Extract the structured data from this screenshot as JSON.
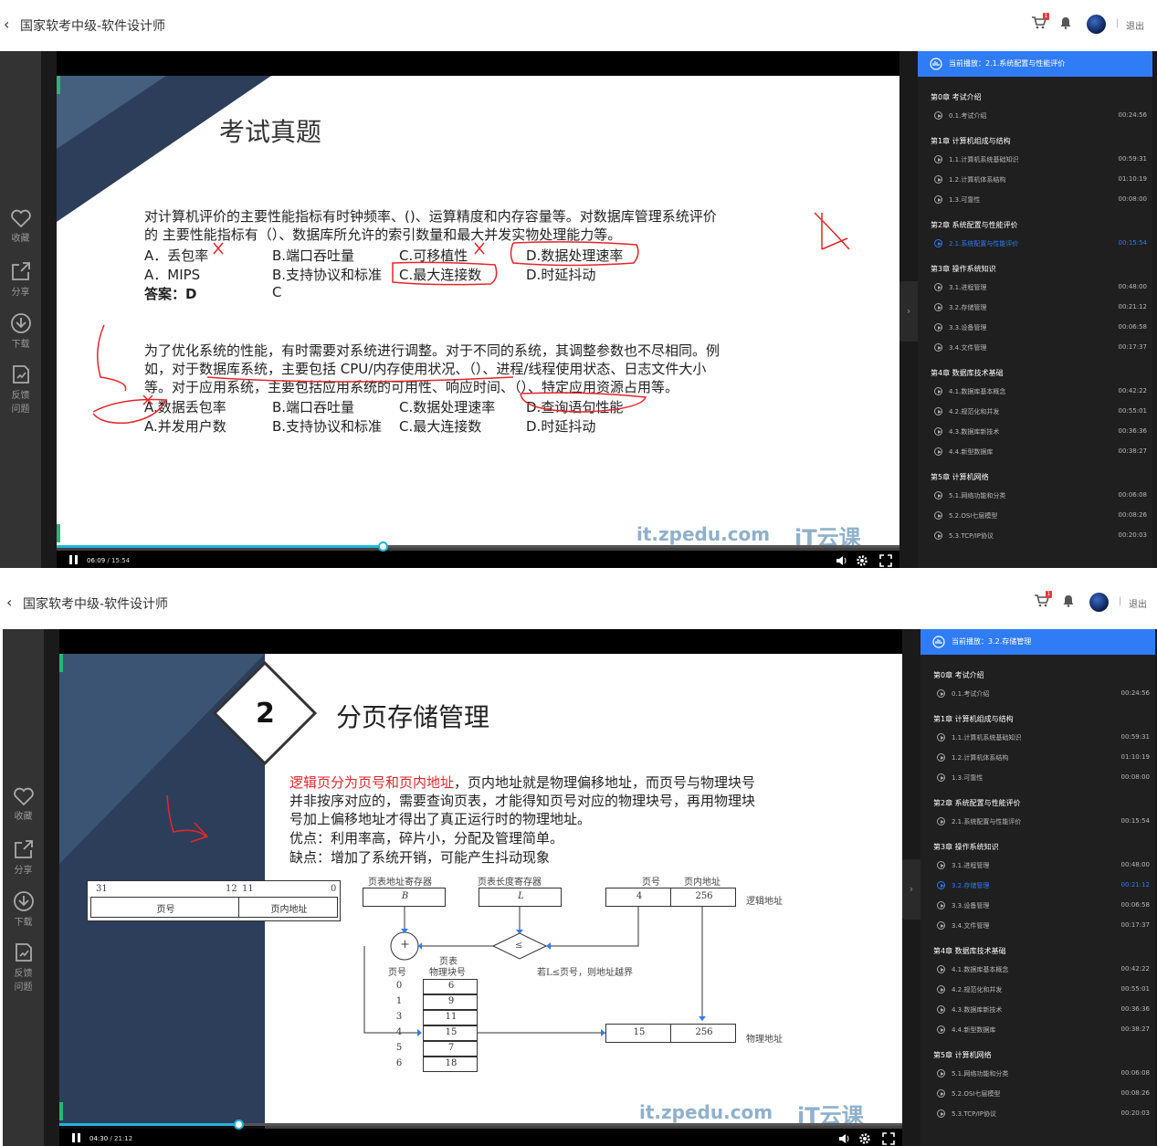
{
  "header": {
    "back_icon": "chevron-left-icon",
    "course_title": "国家软考中级-软件设计师",
    "cart_badge": "1",
    "separator": "|",
    "logout": "退出"
  },
  "leftbar": {
    "favorite": "收藏",
    "share": "分享",
    "download": "下载",
    "feedback_1": "反馈",
    "feedback_2": "问题"
  },
  "colors": {
    "accent": "#2f7cf6",
    "progress": "#27b3d9",
    "annotation": "#e3262b"
  },
  "player1": {
    "current_time": "06:09",
    "total_time": "15:54",
    "progress": 0.387,
    "now_playing": "当前播放：2.1.系统配置与性能评价"
  },
  "player2": {
    "current_time": "04:30",
    "total_time": "21:12",
    "progress": 0.212,
    "now_playing": "当前播放：3.2.存储管理"
  },
  "playlist": [
    {
      "chapter": "第0章 考试介绍",
      "lessons": [
        {
          "name": "0.1.考试介绍",
          "duration": "00:24:56"
        }
      ]
    },
    {
      "chapter": "第1章 计算机组成与结构",
      "lessons": [
        {
          "name": "1.1.计算机系统基础知识",
          "duration": "00:59:31"
        },
        {
          "name": "1.2.计算机体系结构",
          "duration": "01:10:19"
        },
        {
          "name": "1.3.可靠性",
          "duration": "00:08:00"
        }
      ]
    },
    {
      "chapter": "第2章 系统配置与性能评价",
      "lessons": [
        {
          "name": "2.1.系统配置与性能评价",
          "duration": "00:15:54"
        }
      ]
    },
    {
      "chapter": "第3章 操作系统知识",
      "lessons": [
        {
          "name": "3.1.进程管理",
          "duration": "00:48:00"
        },
        {
          "name": "3.2.存储管理",
          "duration": "00:21:12"
        },
        {
          "name": "3.3.设备管理",
          "duration": "00:06:58"
        },
        {
          "name": "3.4.文件管理",
          "duration": "00:17:37"
        }
      ]
    },
    {
      "chapter": "第4章 数据库技术基础",
      "lessons": [
        {
          "name": "4.1.数据库基本概念",
          "duration": "00:42:22"
        },
        {
          "name": "4.2.规范化和并发",
          "duration": "00:55:01"
        },
        {
          "name": "4.3.数据库新技术",
          "duration": "00:36:36"
        },
        {
          "name": "4.4.新型数据库",
          "duration": "00:38:27"
        }
      ]
    },
    {
      "chapter": "第5章 计算机网络",
      "lessons": [
        {
          "name": "5.1.网络功能和分类",
          "duration": "00:06:08"
        },
        {
          "name": "5.2.OSI七层模型",
          "duration": "00:08:26"
        },
        {
          "name": "5.3.TCP/IP协议",
          "duration": "00:20:03"
        }
      ]
    }
  ],
  "slide1": {
    "title": "考试真题",
    "q1_line1": "对计算机评价的主要性能指标有时钟频率、()、运算精度和内存容量等。对数据库管理系统评价",
    "q1_line2": "的 主要性能指标有（）、数据库所允许的索引数量和最大并发实物处理能力等。",
    "q1_opts_row1": [
      "A．丢包率",
      "B.端口吞吐量",
      "C.可移植性",
      "D.数据处理速率"
    ],
    "q1_opts_row2": [
      "A．MIPS",
      "B.支持协议和标准",
      "C.最大连接数",
      "D.时延抖动"
    ],
    "answer": "答案：D",
    "answer2": "C",
    "q2_line1": "为了优化系统的性能，有时需要对系统进行调整。对于不同的系统，其调整参数也不尽相同。例",
    "q2_line2": "如，对于数据库系统，主要包括 CPU/内存使用状况、（）、进程/线程使用状态、日志文件大小",
    "q2_line3": "等。对于应用系统，主要包括应用系统的可用性、响应时间、（）、特定应用资源占用等。",
    "q2_opts_row1": [
      "A.数据丢包率",
      "B.端口吞吐量",
      "C.数据处理速率",
      "D.查询语句性能"
    ],
    "q2_opts_row2": [
      "A.并发用户数",
      "B.支持协议和标准",
      "C.最大连接数",
      "D.时延抖动"
    ],
    "watermark_url": "it.zpedu.com",
    "watermark_brand": "iT云课"
  },
  "slide2": {
    "number": "2",
    "title": "分页存储管理",
    "line1_red": "逻辑页分为页号和页内地址",
    "line1_rest": "，页内地址就是物理偏移地址，而页号与物理块号",
    "line2": "并非按序对应的，需要查询页表，才能得知页号对应的物理块号，再用物理块",
    "line3": "号加上偏移地址才得出了真正运行时的物理地址。",
    "line4": "优点：利用率高，碎片小，分配及管理简单。",
    "line5": "缺点：增加了系统开销，可能产生抖动现象",
    "diagram": {
      "addr_bits": [
        "31",
        "12",
        "11",
        "0"
      ],
      "addr_fields": [
        "页号",
        "页内地址"
      ],
      "reg1_label": "页表地址寄存器",
      "reg1_val": "B",
      "reg2_label": "页表长度寄存器",
      "reg2_val": "L",
      "la_labels": [
        "页号",
        "页内地址"
      ],
      "la_vals": [
        "4",
        "256"
      ],
      "logical_label": "逻辑地址",
      "compare": "≤",
      "overflow": "若L≤页号，则地址越界",
      "table_head1": "页号",
      "table_head2": "页表",
      "table_head3": "物理块号",
      "pages": [
        "0",
        "1",
        "3",
        "4",
        "5",
        "6"
      ],
      "blocks": [
        "6",
        "9",
        "11",
        "15",
        "7",
        "18"
      ],
      "pa_vals": [
        "15",
        "256"
      ],
      "physical_label": "物理地址",
      "plus": "+"
    },
    "watermark_url": "it.zpedu.com",
    "watermark_brand": "iT云课"
  }
}
